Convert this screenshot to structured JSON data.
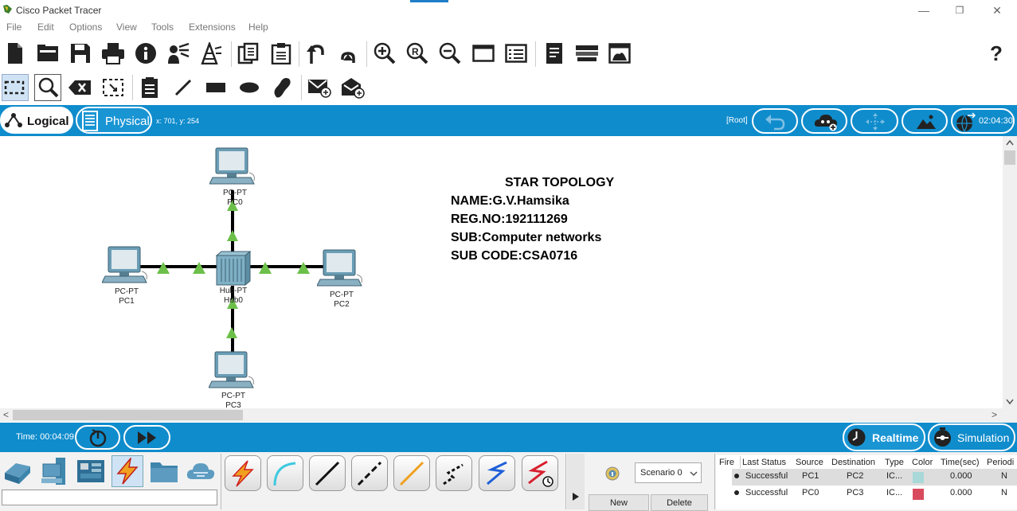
{
  "app": {
    "title": "Cisco Packet Tracer"
  },
  "menu": [
    "File",
    "Edit",
    "Options",
    "View",
    "Tools",
    "Extensions",
    "Help"
  ],
  "window_controls": {
    "minimize": "—",
    "maximize": "❐",
    "close": "✕"
  },
  "main_toolbar": [
    "new-file-icon",
    "open-file-icon",
    "save-icon",
    "print-icon",
    "info-icon",
    "activity-wizard-icon",
    "network-info-icon",
    "copy-icon",
    "paste-icon",
    "undo-icon",
    "redo-icon",
    "zoom-in-icon",
    "zoom-reset-icon",
    "zoom-out-icon",
    "drawing-palette-icon",
    "custom-device-dialog-icon",
    "notes-icon",
    "device-template-icon",
    "viewport-icon",
    "help-icon"
  ],
  "help_glyph": "?",
  "edit_toolbar": [
    "select-icon",
    "inspect-icon",
    "delete-icon",
    "resize-icon",
    "place-note-icon",
    "draw-line-icon",
    "draw-rectangle-icon",
    "draw-ellipse-icon",
    "freeform-icon",
    "add-simple-pdu-icon",
    "add-complex-pdu-icon"
  ],
  "workspace_bar": {
    "logical_label": "Logical",
    "physical_label": "Physical",
    "coords": "x: 701, y: 254",
    "root_label": "[Root]",
    "clock": "02:04:30"
  },
  "topology": {
    "devices": [
      {
        "model": "PC-PT",
        "name": "PC0"
      },
      {
        "model": "PC-PT",
        "name": "PC1"
      },
      {
        "model": "PC-PT",
        "name": "PC2"
      },
      {
        "model": "PC-PT",
        "name": "PC3"
      },
      {
        "model": "Hub-PT",
        "name": "Hub0"
      }
    ],
    "link_color": "#000000",
    "port_status_color": "#6cc04a"
  },
  "note": {
    "title": "STAR TOPOLOGY",
    "lines": [
      "NAME:G.V.Hamsika",
      "REG.NO:192111269",
      "SUB:Computer networks",
      "SUB CODE:CSA0716"
    ]
  },
  "scroll": {
    "left_arrow": "<",
    "right_arrow": ">"
  },
  "timebar": {
    "time": "Time: 00:04:09",
    "realtime_label": "Realtime",
    "simulation_label": "Simulation"
  },
  "device_categories": [
    "network-devices-icon",
    "end-devices-icon",
    "components-icon",
    "connections-icon",
    "miscellaneous-icon",
    "multiuser-icon"
  ],
  "connection_types": [
    "automatic-connection-icon",
    "console-cable-icon",
    "copper-straight-through-icon",
    "copper-cross-over-icon",
    "fiber-icon",
    "phone-cable-icon",
    "coaxial-cable-icon",
    "serial-dce-icon"
  ],
  "scenario": {
    "selected": "Scenario 0",
    "new_label": "New",
    "delete_label": "Delete"
  },
  "pdu_table": {
    "headers": [
      "Fire",
      "Last Status",
      "Source",
      "Destination",
      "Type",
      "Color",
      "Time(sec)",
      "Periodi"
    ],
    "rows": [
      {
        "last_status": "Successful",
        "source": "PC1",
        "destination": "PC2",
        "type": "IC...",
        "color": "#a8d8d8",
        "time": "0.000",
        "periodic": "N"
      },
      {
        "last_status": "Successful",
        "source": "PC0",
        "destination": "PC3",
        "type": "IC...",
        "color": "#d94b5c",
        "time": "0.000",
        "periodic": "N"
      }
    ]
  },
  "colors": {
    "accent": "#0f8ccc"
  }
}
